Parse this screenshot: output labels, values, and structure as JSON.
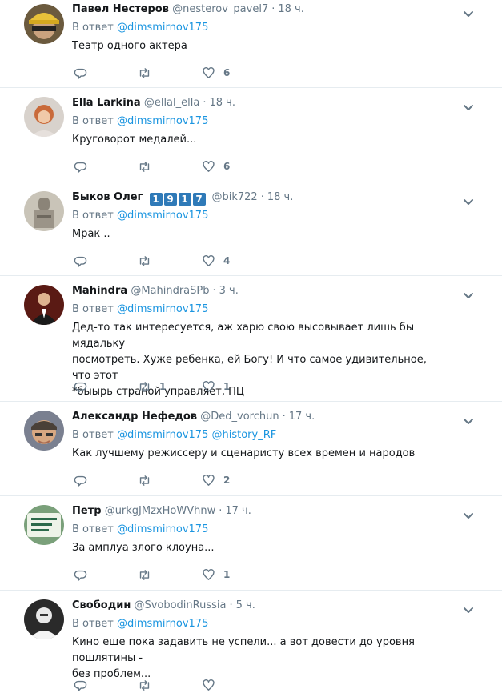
{
  "reply_prefix": "В ответ",
  "tweets": [
    {
      "name": "Павел Нестеров",
      "handle": "@nesterov_pavel7",
      "time": "18 ч.",
      "mentions": [
        "@dimsmirnov175"
      ],
      "lines": [
        "Театр одного актера"
      ],
      "reply_count": "",
      "retweet_count": "",
      "like_count": "6",
      "avatar": "avatar-helmet"
    },
    {
      "name": "Ella Larkina",
      "handle": "@ellal_ella",
      "time": "18 ч.",
      "mentions": [
        "@dimsmirnov175"
      ],
      "lines": [
        "Круговорот медалей..."
      ],
      "reply_count": "",
      "retweet_count": "",
      "like_count": "6",
      "avatar": "avatar-woman"
    },
    {
      "name": "Быков Олег",
      "handle": "@bik722",
      "time": "18 ч.",
      "badges": [
        "1",
        "9",
        "1",
        "7"
      ],
      "mentions": [
        "@dimsmirnov175"
      ],
      "lines": [
        "Мрак .."
      ],
      "reply_count": "",
      "retweet_count": "",
      "like_count": "4",
      "avatar": "avatar-statue"
    },
    {
      "name": "Mahindra",
      "handle": "@MahindraSPb",
      "time": "3 ч.",
      "mentions": [
        "@dimsmirnov175"
      ],
      "lines": [
        "Дед-то так интересуется, аж харю свою высовывает лишь бы мядальку",
        "посмотреть. Хуже ребенка, ей Богу! И что самое удивительное, что этот",
        "*быырь страной управляет, ПЦ"
      ],
      "reply_count": "",
      "retweet_count": "1",
      "like_count": "1",
      "avatar": "avatar-man-suit"
    },
    {
      "name": "Александр Нефедов",
      "handle": "@Ded_vorchun",
      "time": "17 ч.",
      "mentions": [
        "@dimsmirnov175",
        "@history_RF"
      ],
      "lines": [
        "Как лучшему режиссеру и сценаристу всех времен и народов"
      ],
      "reply_count": "",
      "retweet_count": "",
      "like_count": "2",
      "avatar": "avatar-old-man"
    },
    {
      "name": "Петр",
      "handle": "@urkgJMzxHoWVhnw",
      "time": "17 ч.",
      "mentions": [
        "@dimsmirnov175"
      ],
      "lines": [
        "За амплуа злого клоуна..."
      ],
      "reply_count": "",
      "retweet_count": "",
      "like_count": "1",
      "avatar": "avatar-sign"
    },
    {
      "name": "Свободин",
      "handle": "@SvobodinRussia",
      "time": "5 ч.",
      "mentions": [
        "@dimsmirnov175"
      ],
      "lines": [
        "Кино еще пока задавить не успели... а вот довести до уровня пошлятины -",
        "без проблем..."
      ],
      "reply_count": "",
      "retweet_count": "",
      "like_count": "",
      "avatar": "avatar-bw-man"
    }
  ],
  "colors": {
    "link": "#1b95e0",
    "muted": "#657786",
    "badge": "#2f7ab8",
    "divider": "#e6ecf0"
  }
}
